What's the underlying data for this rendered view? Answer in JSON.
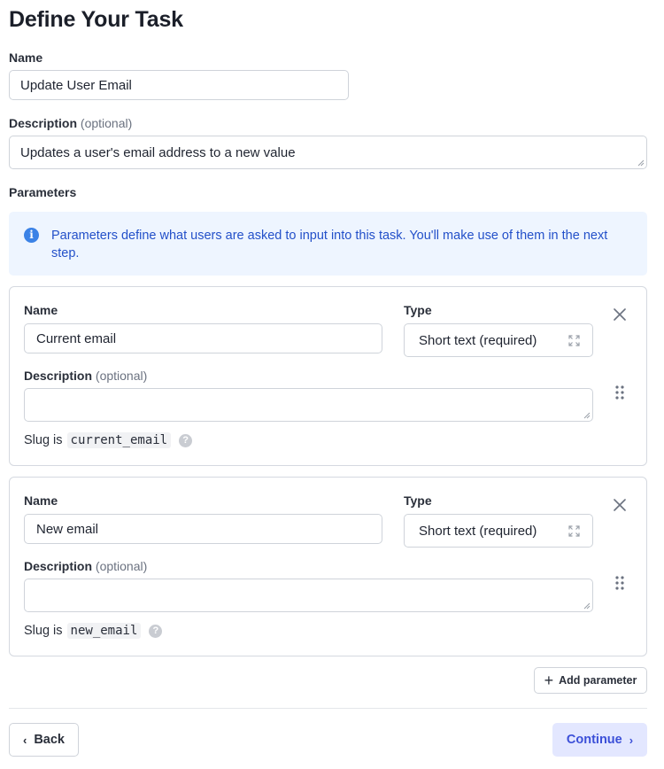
{
  "page": {
    "title": "Define Your Task"
  },
  "task": {
    "name_label": "Name",
    "name_value": "Update User Email",
    "description_label": "Description",
    "optional_label": "(optional)",
    "description_value": "Updates a user's email address to a new value"
  },
  "parameters": {
    "label": "Parameters",
    "info_text": "Parameters define what users are asked to input into this task. You'll make use of them in the next step.",
    "slug_prefix": "Slug is",
    "items": [
      {
        "name_label": "Name",
        "name_value": "Current email",
        "type_label": "Type",
        "type_value": "Short text (required)",
        "description_label": "Description",
        "optional_label": "(optional)",
        "description_value": "",
        "slug": "current_email"
      },
      {
        "name_label": "Name",
        "name_value": "New email",
        "type_label": "Type",
        "type_value": "Short text (required)",
        "description_label": "Description",
        "optional_label": "(optional)",
        "description_value": "",
        "slug": "new_email"
      }
    ],
    "add_label": "Add parameter"
  },
  "footer": {
    "back_label": "Back",
    "continue_label": "Continue"
  },
  "colors": {
    "accent": "#3b4fd8",
    "info_bg": "#eef5ff",
    "info_text": "#2350c9"
  }
}
